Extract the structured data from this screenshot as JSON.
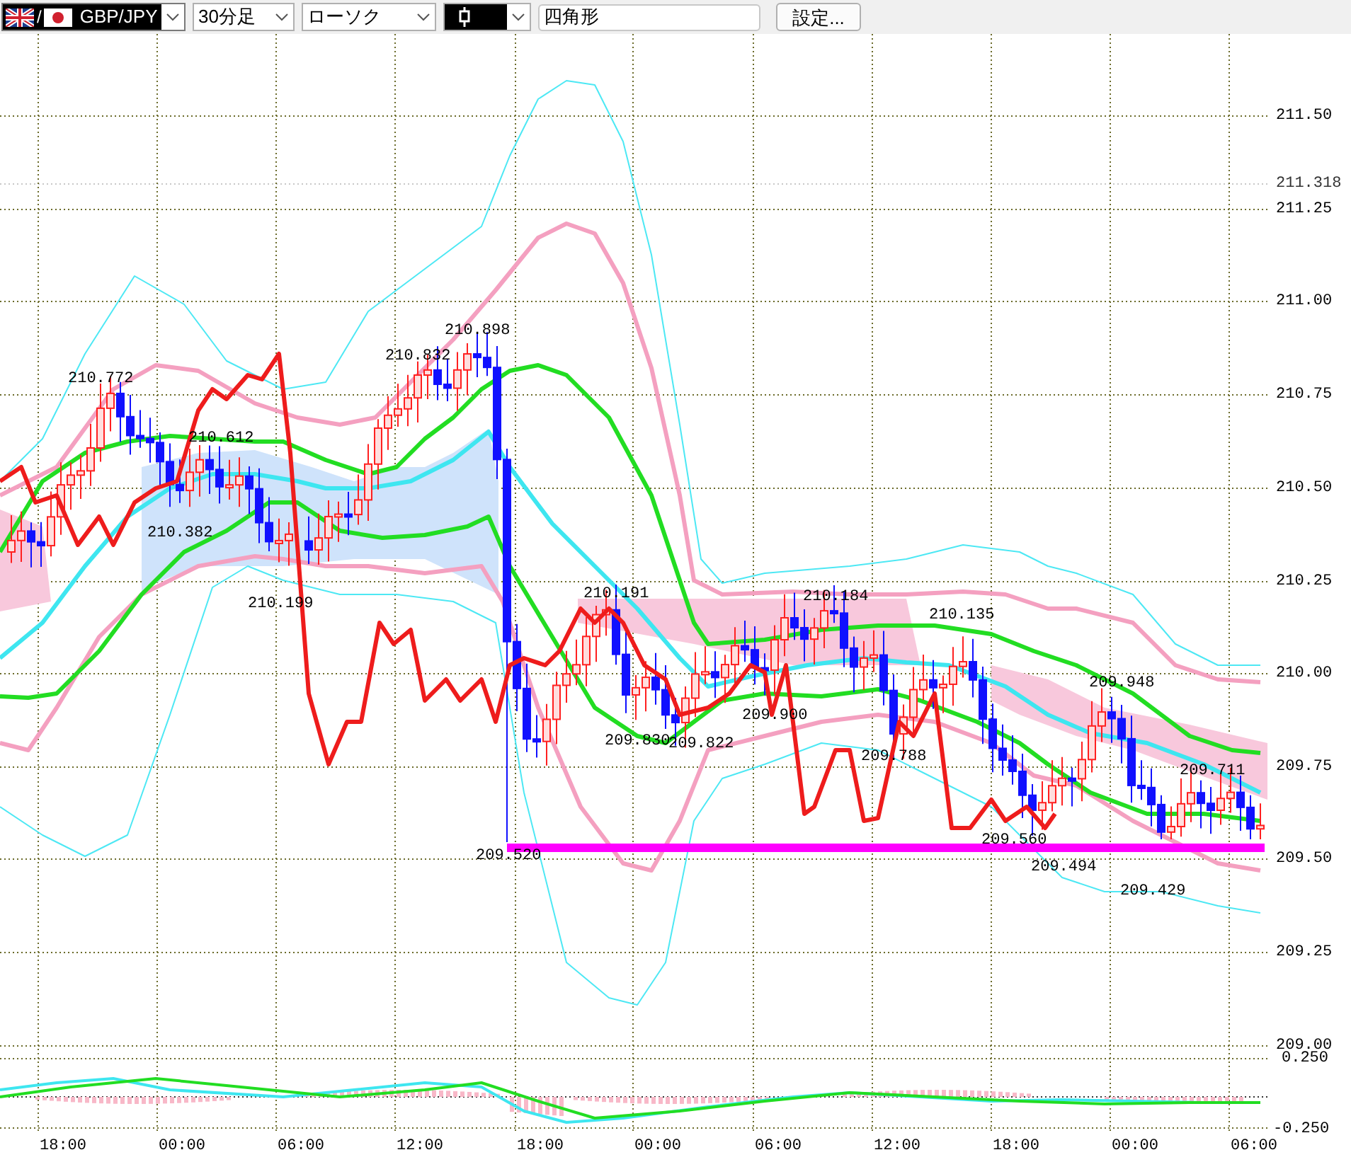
{
  "toolbar": {
    "symbol": {
      "separator": "/",
      "value": "GBP/JPY"
    },
    "timeframe": {
      "value": "30分足"
    },
    "chart_type": {
      "value": "ローソク"
    },
    "drawing_tool": {
      "value": "四角形"
    },
    "settings_button": "設定..."
  },
  "price_axis": [
    {
      "label": "211.50",
      "kind": "tick"
    },
    {
      "label": "211.318",
      "kind": "marker"
    },
    {
      "label": "211.25",
      "kind": "tick"
    },
    {
      "label": "211.00",
      "kind": "tick"
    },
    {
      "label": "210.75",
      "kind": "tick"
    },
    {
      "label": "210.50",
      "kind": "tick"
    },
    {
      "label": "210.25",
      "kind": "tick"
    },
    {
      "label": "210.00",
      "kind": "tick"
    },
    {
      "label": "209.75",
      "kind": "tick"
    },
    {
      "label": "209.50",
      "kind": "tick"
    },
    {
      "label": "209.25",
      "kind": "tick"
    },
    {
      "label": "209.00",
      "kind": "tick"
    }
  ],
  "oscillator_axis": [
    "0.250",
    "-0.250"
  ],
  "time_axis": [
    "18:00",
    "00:00",
    "06:00",
    "12:00",
    "18:00",
    "00:00",
    "06:00",
    "12:00",
    "18:00",
    "00:00",
    "06:00"
  ],
  "price_labels": [
    "210.772",
    "210.612",
    "210.382",
    "210.199",
    "210.832",
    "210.898",
    "210.191",
    "210.184",
    "210.135",
    "209.830",
    "209.822",
    "209.900",
    "209.788",
    "209.948",
    "209.711",
    "209.560",
    "209.494",
    "209.429",
    "209.520"
  ]
}
